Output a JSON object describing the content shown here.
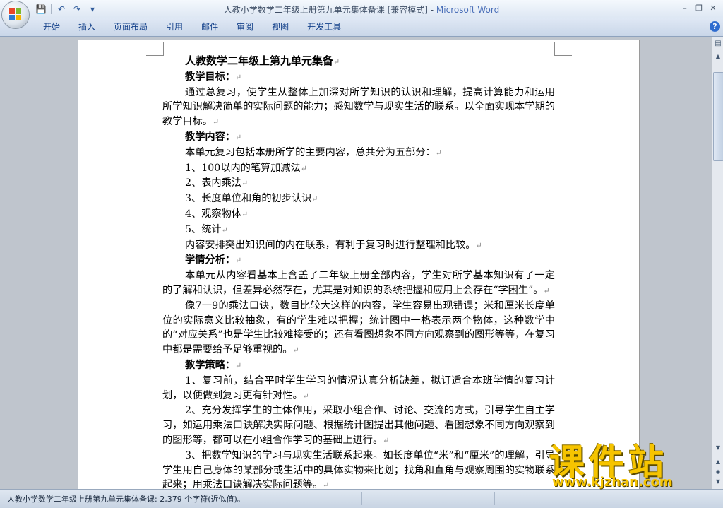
{
  "window": {
    "title": "人教小学数学二年级上册第九单元集体备课 [兼容模式] - ",
    "app_name": "Microsoft Word",
    "controls": [
      "–",
      "❐",
      "✕"
    ]
  },
  "quick_access": {
    "save": "💾",
    "undo": "↶",
    "redo": "↷",
    "customize": "▾"
  },
  "ribbon": {
    "tabs": [
      "开始",
      "插入",
      "页面布局",
      "引用",
      "邮件",
      "审阅",
      "视图",
      "开发工具"
    ],
    "help": "?"
  },
  "document": {
    "paragraph_mark": "↵",
    "paragraphs": [
      {
        "text": "人教数学二年级上第九单元集备",
        "style": "title"
      },
      {
        "text": "教学目标：",
        "style": "h"
      },
      {
        "text": "通过总复习，使学生从整体上加深对所学知识的认识和理解，提高计算能力和运用所学知识解决简单的实际问题的能力；感知数学与现实生活的联系。以全面实现本学期的教学目标。",
        "style": "body"
      },
      {
        "text": "教学内容：",
        "style": "h"
      },
      {
        "text": "本单元复习包括本册所学的主要内容，总共分为五部分：",
        "style": "body"
      },
      {
        "text": "1、100以内的笔算加减法",
        "style": "body"
      },
      {
        "text": "2、表内乘法",
        "style": "body"
      },
      {
        "text": "3、长度单位和角的初步认识",
        "style": "body"
      },
      {
        "text": "4、观察物体",
        "style": "body"
      },
      {
        "text": "5、统计",
        "style": "body"
      },
      {
        "text": "内容安排突出知识间的内在联系，有利于复习时进行整理和比较。",
        "style": "body"
      },
      {
        "text": "学情分析：",
        "style": "h"
      },
      {
        "text": "本单元从内容看基本上含盖了二年级上册全部内容，学生对所学基本知识有了一定的了解和认识，但差异必然存在，尤其是对知识的系统把握和应用上会存在“学困生”。",
        "style": "body"
      },
      {
        "text": "像7一9的乘法口诀，数目比较大这样的内容，学生容易出现错误；米和厘米长度单位的实际意义比较抽象，有的学生难以把握；统计图中一格表示两个物体，这种数学中的“对应关系”也是学生比较难接受的；还有看图想象不同方向观察到的图形等等，在复习中都是需要给予足够重视的。",
        "style": "body"
      },
      {
        "text": "教学策略：",
        "style": "h"
      },
      {
        "text": "1、复习前，结合平时学生学习的情况认真分析缺差，拟订适合本班学情的复习计划，以便做到复习更有针对性。",
        "style": "body"
      },
      {
        "text": "2、充分发挥学生的主体作用，采取小组合作、讨论、交流的方式，引导学生自主学习，如运用乘法口诀解决实际问题、根据统计图提出其他问题、看图想象不同方向观察到的图形等，都可以在小组合作学习的基础上进行。",
        "style": "body"
      },
      {
        "text": "3、把数学知识的学习与现实生活联系起来。如长度单位“米”和“厘米”的理解，引导学生用自己身体的某部分或生活中的具体实物来比划；找角和直角与观察周围的实物联系起来；用乘法口诀解决实际问题等。",
        "style": "body"
      }
    ]
  },
  "scrollbar": {
    "ruler_toggle": "▤",
    "up": "▲",
    "down": "▼",
    "prev": "◉",
    "next": "▾"
  },
  "status_bar": {
    "text": "人教小学数学二年级上册第九单元集体备课: 2,379 个字符(近似值)。"
  },
  "watermark": {
    "cn": "课件站",
    "url": "www.kjzhan.com"
  }
}
